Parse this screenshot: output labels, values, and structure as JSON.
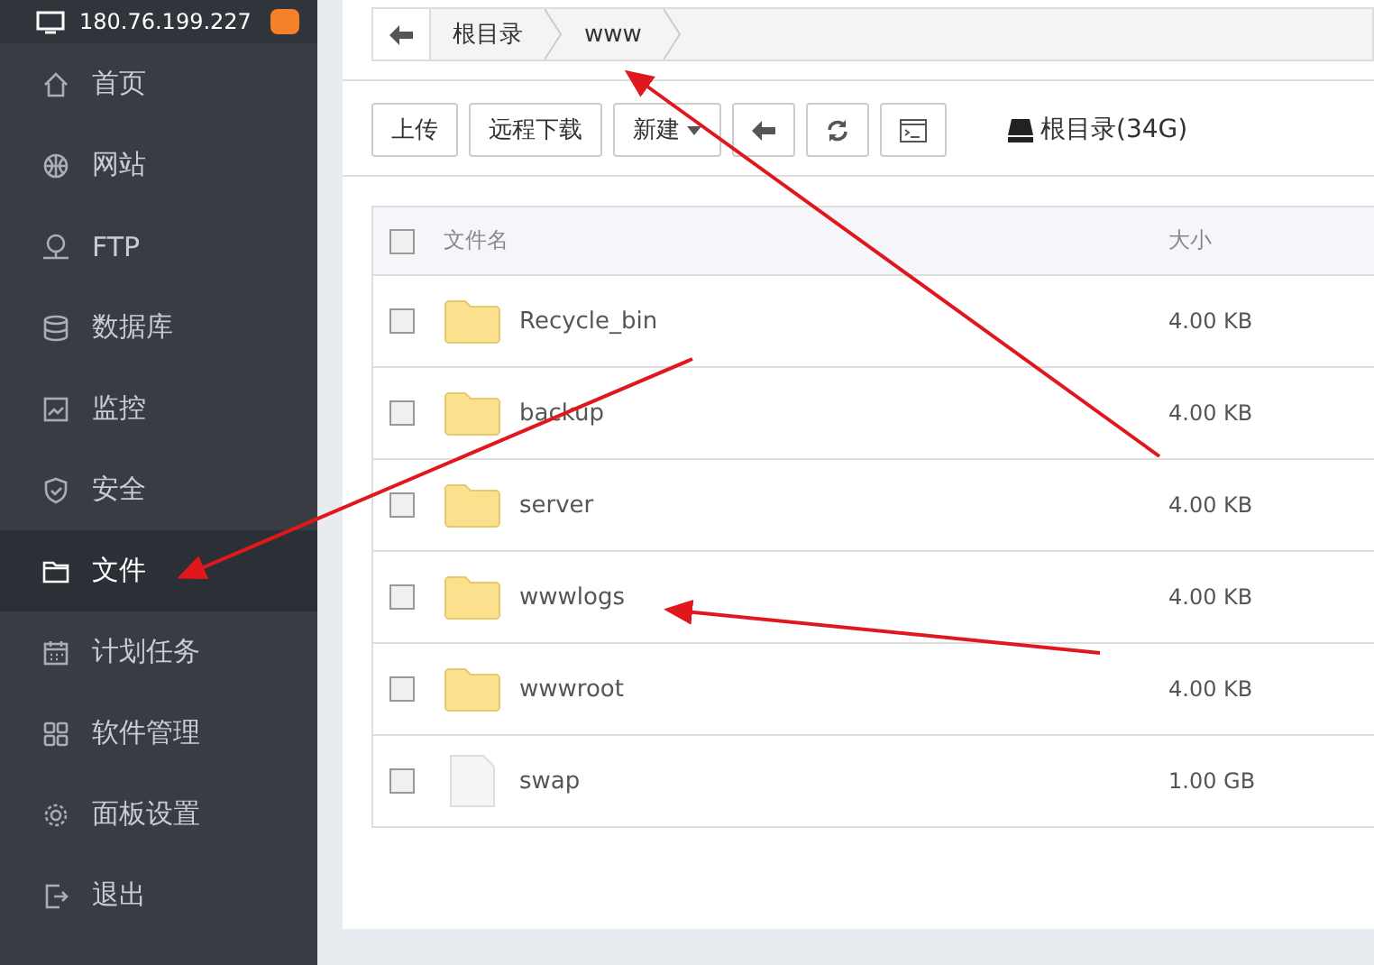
{
  "header": {
    "host": "180.76.199.227"
  },
  "sidebar": {
    "items": [
      {
        "kind": "home",
        "label": "首页",
        "selected": false
      },
      {
        "kind": "globe",
        "label": "网站",
        "selected": false
      },
      {
        "kind": "ftp",
        "label": "FTP",
        "selected": false
      },
      {
        "kind": "database",
        "label": "数据库",
        "selected": false
      },
      {
        "kind": "monitor",
        "label": "监控",
        "selected": false
      },
      {
        "kind": "shield",
        "label": "安全",
        "selected": false
      },
      {
        "kind": "folder",
        "label": "文件",
        "selected": true
      },
      {
        "kind": "calendar",
        "label": "计划任务",
        "selected": false
      },
      {
        "kind": "grid",
        "label": "软件管理",
        "selected": false
      },
      {
        "kind": "gear",
        "label": "面板设置",
        "selected": false
      },
      {
        "kind": "exit",
        "label": "退出",
        "selected": false
      }
    ]
  },
  "breadcrumb": [
    "根目录",
    "www"
  ],
  "toolbar": {
    "buttons": [
      {
        "kind": "text",
        "label": "上传"
      },
      {
        "kind": "text",
        "label": "远程下载"
      },
      {
        "kind": "dropdown",
        "label": "新建"
      },
      {
        "kind": "back"
      },
      {
        "kind": "refresh"
      },
      {
        "kind": "terminal"
      }
    ],
    "disk": "根目录(34G)"
  },
  "table": {
    "columns": [
      "文件名",
      "大小"
    ],
    "all_checked": false,
    "rows": [
      {
        "kind": "folder",
        "name": "Recycle_bin",
        "size": "4.00 KB",
        "checked": false
      },
      {
        "kind": "folder",
        "name": "backup",
        "size": "4.00 KB",
        "checked": false
      },
      {
        "kind": "folder",
        "name": "server",
        "size": "4.00 KB",
        "checked": false
      },
      {
        "kind": "folder",
        "name": "wwwlogs",
        "size": "4.00 KB",
        "checked": false
      },
      {
        "kind": "folder",
        "name": "wwwroot",
        "size": "4.00 KB",
        "checked": false
      },
      {
        "kind": "file",
        "name": "swap",
        "size": "1.00 GB",
        "checked": false
      }
    ]
  }
}
